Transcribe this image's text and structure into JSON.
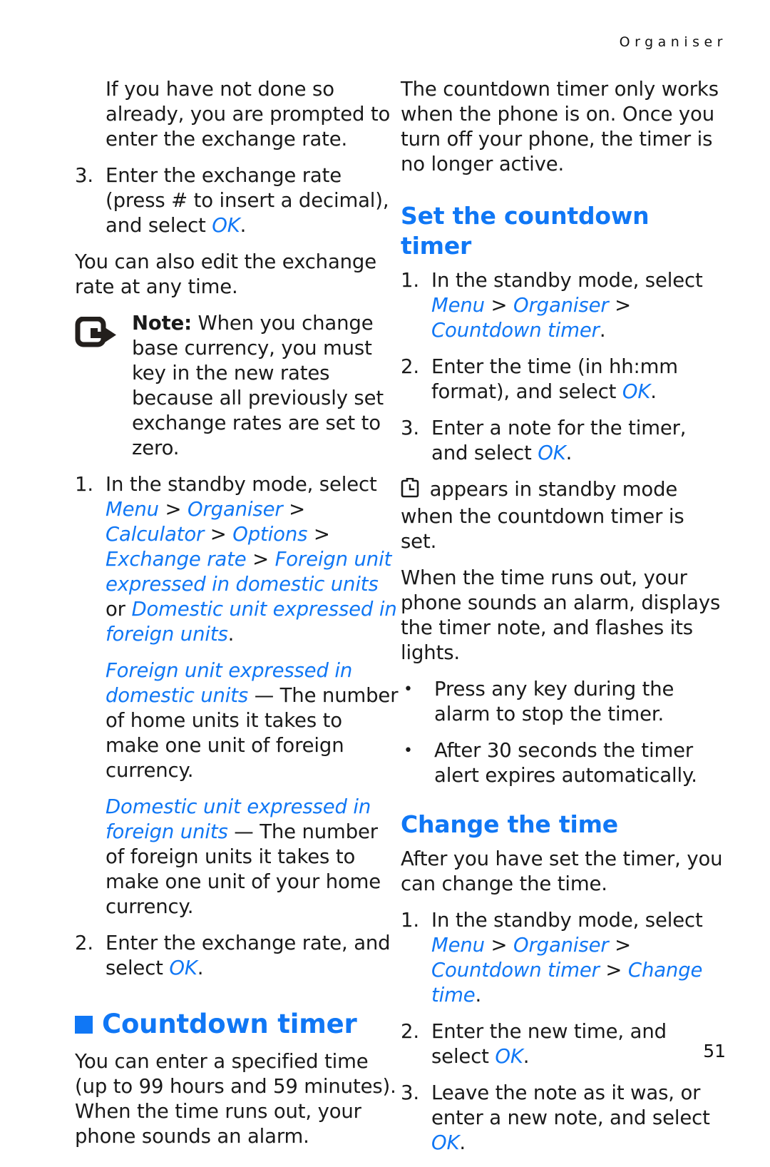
{
  "page": {
    "running_head": "Organiser",
    "folio": "51"
  },
  "left_column": {
    "para_continuation": "If you have not done so already, you are prompted to enter the exchange rate.",
    "step3": {
      "marker": "3.",
      "text_before": "Enter the exchange rate (press # to insert a decimal), and select ",
      "ui": "OK",
      "text_after": "."
    },
    "para_edit": "You can also edit the exchange rate at any time.",
    "note": {
      "icon": "note-pointer-icon",
      "label": "Note:",
      "text": " When you change base currency, you must key in the new rates because all previously set exchange rates are set to zero."
    },
    "step1": {
      "marker": "1.",
      "lead": "In the standby mode, select ",
      "path": [
        {
          "kind": "ui",
          "text": "Menu"
        },
        {
          "kind": "sep",
          "text": " > "
        },
        {
          "kind": "ui",
          "text": "Organiser"
        },
        {
          "kind": "sep",
          "text": " > "
        },
        {
          "kind": "ui",
          "text": "Calculator"
        },
        {
          "kind": "sep",
          "text": " > "
        },
        {
          "kind": "ui",
          "text": "Options"
        },
        {
          "kind": "sep",
          "text": " > "
        },
        {
          "kind": "ui",
          "text": "Exchange rate"
        },
        {
          "kind": "sep",
          "text": " > "
        },
        {
          "kind": "ui",
          "text": "Foreign unit expressed in domestic units"
        },
        {
          "kind": "sep",
          "text": " or "
        },
        {
          "kind": "ui",
          "text": "Domestic unit expressed in foreign units"
        },
        {
          "kind": "sep",
          "text": "."
        }
      ]
    },
    "def_foreign": {
      "term": "Foreign unit expressed in domestic units",
      "body": " — The number of home units it takes to make one unit of foreign currency."
    },
    "def_domestic": {
      "term": "Domestic unit expressed in foreign units",
      "body": " — The number of foreign units it takes to make one unit of your home currency."
    },
    "step2": {
      "marker": "2.",
      "text_before": "Enter the exchange rate, and select ",
      "ui": "OK",
      "text_after": "."
    },
    "chapter_heading": "Countdown timer",
    "chapter_para": "You can enter a specified time (up to 99 hours and 59 minutes). When the time runs out, your phone sounds an alarm."
  },
  "right_column": {
    "para_only_works": "The countdown timer only works when the phone is on. Once you turn off your phone, the timer is no longer active.",
    "heading_set": "Set the countdown timer",
    "set_step1": {
      "marker": "1.",
      "lead": "In the standby mode, select ",
      "path": [
        {
          "kind": "ui",
          "text": "Menu"
        },
        {
          "kind": "sep",
          "text": " > "
        },
        {
          "kind": "ui",
          "text": "Organiser"
        },
        {
          "kind": "sep",
          "text": " > "
        },
        {
          "kind": "ui",
          "text": "Countdown timer"
        },
        {
          "kind": "sep",
          "text": "."
        }
      ]
    },
    "set_step2": {
      "marker": "2.",
      "text_before": "Enter the time (in hh:mm format), and select ",
      "ui": "OK",
      "text_after": "."
    },
    "set_step3": {
      "marker": "3.",
      "text_before": "Enter a note for the timer, and select ",
      "ui": "OK",
      "text_after": "."
    },
    "icon_para": {
      "icon": "countdown-timer-icon",
      "text": " appears in standby mode when the countdown timer is set."
    },
    "para_runs_out": "When the time runs out, your phone sounds an alarm, displays the timer note, and flashes its lights.",
    "bullets": [
      {
        "marker": "•",
        "text": "Press any key during the alarm to stop the timer."
      },
      {
        "marker": "•",
        "text": "After 30 seconds the timer alert expires automatically."
      }
    ],
    "heading_change": "Change the time",
    "para_after_set": "After you have set the timer, you can change the time.",
    "change_step1": {
      "marker": "1.",
      "lead": "In the standby mode, select ",
      "path": [
        {
          "kind": "ui",
          "text": "Menu"
        },
        {
          "kind": "sep",
          "text": " > "
        },
        {
          "kind": "ui",
          "text": "Organiser"
        },
        {
          "kind": "sep",
          "text": " > "
        },
        {
          "kind": "ui",
          "text": "Countdown timer"
        },
        {
          "kind": "sep",
          "text": " > "
        },
        {
          "kind": "ui",
          "text": "Change time"
        },
        {
          "kind": "sep",
          "text": "."
        }
      ]
    },
    "change_step2": {
      "marker": "2.",
      "text_before": "Enter the new time, and select ",
      "ui": "OK",
      "text_after": "."
    },
    "change_step3": {
      "marker": "3.",
      "text_before": "Leave the note as it was, or enter a new note, and select ",
      "ui": "OK",
      "text_after": "."
    }
  },
  "colors": {
    "accent_blue": "#1077f5",
    "body_text": "#1a1a1a",
    "page_background": "#ffffff"
  }
}
